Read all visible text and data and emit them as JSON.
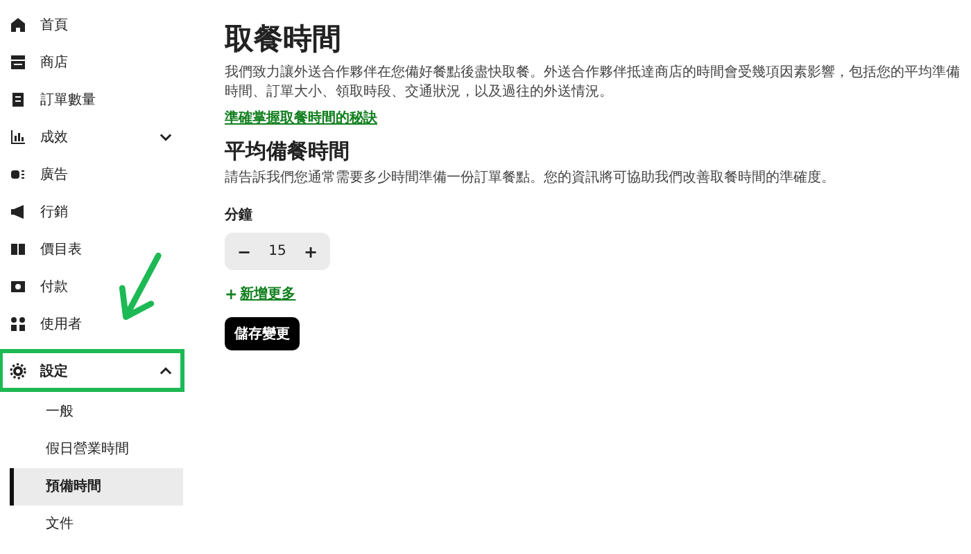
{
  "sidebar": {
    "items": [
      {
        "label": "首頁"
      },
      {
        "label": "商店"
      },
      {
        "label": "訂單數量"
      },
      {
        "label": "成效",
        "expanded": false
      },
      {
        "label": "廣告"
      },
      {
        "label": "行銷"
      },
      {
        "label": "價目表"
      },
      {
        "label": "付款"
      },
      {
        "label": "使用者"
      },
      {
        "label": "設定",
        "expanded": true,
        "highlighted": true,
        "children": [
          {
            "label": "一般",
            "selected": false
          },
          {
            "label": "假日營業時間",
            "selected": false
          },
          {
            "label": "預備時間",
            "selected": true
          },
          {
            "label": "文件",
            "selected": false
          }
        ]
      }
    ]
  },
  "main": {
    "title": "取餐時間",
    "description": "我們致力讓外送合作夥伴在您備好餐點後盡快取餐。外送合作夥伴抵達商店的時間會受幾項因素影響，包括您的平均準備時間、訂單大小、領取時段、交通狀況，以及過往的外送情況。",
    "link": "準確掌握取餐時間的秘訣",
    "section_title": "平均備餐時間",
    "section_description": "請告訴我們您通常需要多少時間準備一份訂單餐點。您的資訊將可協助我們改善取餐時間的準確度。",
    "field_label": "分鐘",
    "stepper": {
      "decrement": "−",
      "value": "15",
      "increment": "+"
    },
    "add_more": {
      "icon": "+",
      "label": "新增更多"
    },
    "save_button": "儲存變更"
  }
}
